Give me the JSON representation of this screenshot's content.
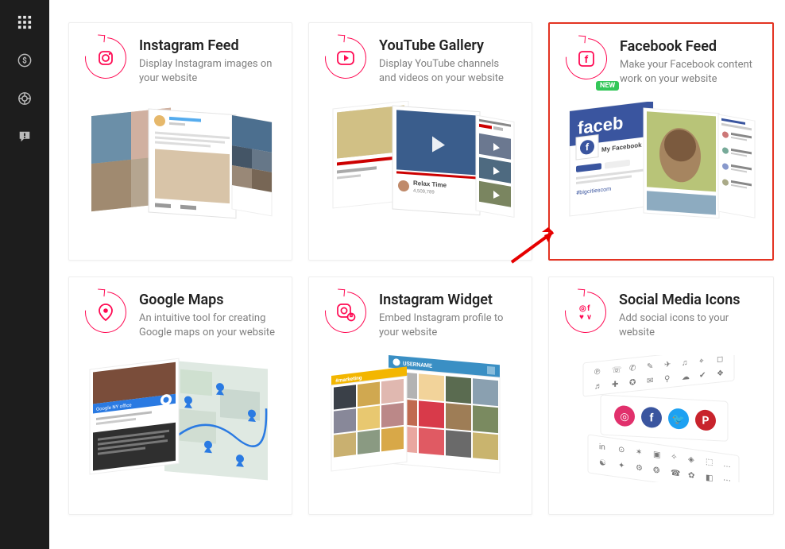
{
  "sidebar": {
    "items": [
      "apps-icon",
      "dollar-icon",
      "lifebuoy-icon",
      "feedback-icon"
    ]
  },
  "cards": [
    {
      "title": "Instagram Feed",
      "desc": "Display Instagram images on your website",
      "badge": null,
      "highlight": false,
      "icon": "instagram-icon"
    },
    {
      "title": "YouTube Gallery",
      "desc": "Display YouTube channels and videos on your website",
      "badge": null,
      "highlight": false,
      "icon": "youtube-icon"
    },
    {
      "title": "Facebook Feed",
      "desc": "Make your Facebook content work on your website",
      "badge": "NEW",
      "highlight": true,
      "icon": "facebook-icon"
    },
    {
      "title": "Google Maps",
      "desc": "An intuitive tool for creating Google maps on your website",
      "badge": null,
      "highlight": false,
      "icon": "maps-icon"
    },
    {
      "title": "Instagram Widget",
      "desc": "Embed Instagram profile to your website",
      "badge": null,
      "highlight": false,
      "icon": "instagram-widget-icon"
    },
    {
      "title": "Social Media Icons",
      "desc": "Add social icons to your website",
      "badge": null,
      "highlight": false,
      "icon": "social-icons-icon"
    }
  ],
  "annotation": {
    "arrow_target": "Facebook Feed"
  }
}
